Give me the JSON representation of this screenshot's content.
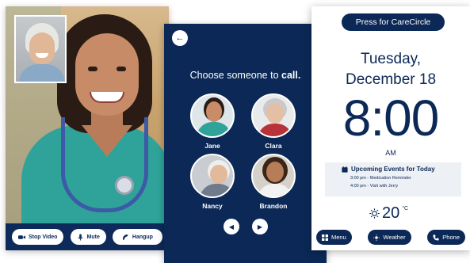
{
  "video_call": {
    "buttons": {
      "stop_video": "Stop Video",
      "mute": "Mute",
      "hangup": "Hangup"
    },
    "icons": [
      "video-camera-icon",
      "microphone-icon",
      "phone-hangup-icon"
    ]
  },
  "contacts_screen": {
    "title_prefix": "Choose someone to ",
    "title_emphasis": "call.",
    "contacts": [
      {
        "name": "Jane"
      },
      {
        "name": "Clara"
      },
      {
        "name": "Nancy"
      },
      {
        "name": "Brandon"
      }
    ],
    "nav": {
      "prev": "◀",
      "next": "▶",
      "back": "←"
    }
  },
  "clock_screen": {
    "carecircle_button": "Press for CareCircle",
    "day": "Tuesday,",
    "date": "December 18",
    "time": "8:00",
    "ampm": "AM",
    "events_title": "Upcoming Events for Today",
    "events": [
      "3:00 pm - Medication Reminder",
      "4:00 pm - Visit with Jerry"
    ],
    "temperature": "20",
    "temperature_unit": "°C",
    "buttons": {
      "menu": "Menu",
      "weather": "Weather",
      "phone": "Phone"
    }
  },
  "colors": {
    "navy": "#0b2856",
    "scrubs": "#2fa39a",
    "event_bg": "#edf0f4"
  }
}
